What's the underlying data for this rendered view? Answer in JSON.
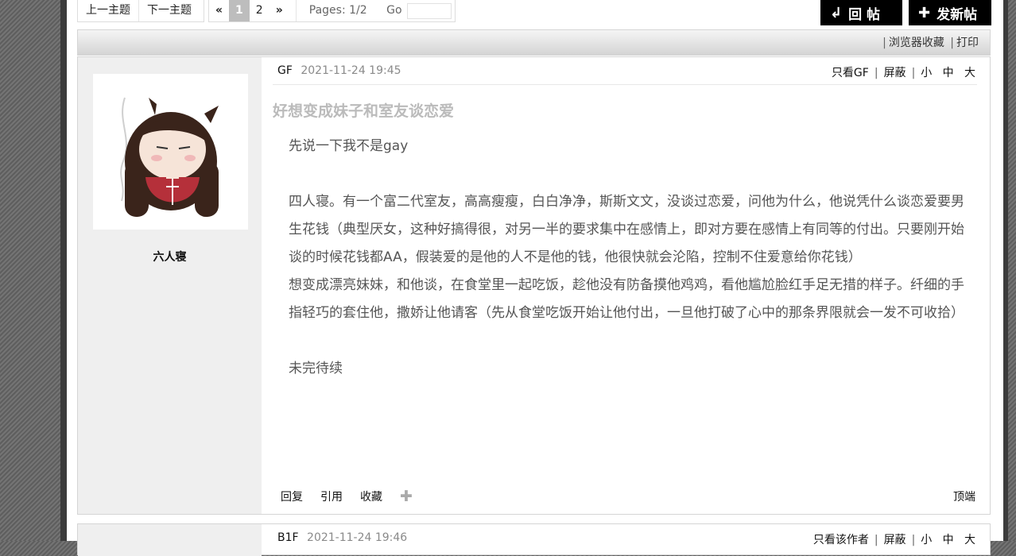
{
  "nav": {
    "prev_topic": "上一主题",
    "next_topic": "下一主题"
  },
  "pagination": {
    "prev": "«",
    "pages": [
      "1",
      "2"
    ],
    "current": "1",
    "next": "»",
    "info": "Pages: 1/2",
    "go": "Go"
  },
  "buttons": {
    "reply_icon": "↲",
    "reply": "回 帖",
    "new_icon": "✚",
    "new_post": "发新帖"
  },
  "toolbar": {
    "bookmark": "浏览器收藏",
    "print": "打印"
  },
  "post1": {
    "author": "GF",
    "date": "2021-11-24 19:45",
    "only_author": "只看GF",
    "block": "屏蔽",
    "size_small": "小",
    "size_medium": "中",
    "size_large": "大",
    "username": "六人寝",
    "title": "好想变成妹子和室友谈恋爱",
    "p1": "先说一下我不是gay",
    "p2": "四人寝。有一个富二代室友，高高瘦瘦，白白净净，斯斯文文，没谈过恋爱，问他为什么，他说凭什么谈恋爱要男生花钱（典型厌女，这种好搞得很，对另一半的要求集中在感情上，即对方要在感情上有同等的付出。只要刚开始谈的时候花钱都AA，假装爱的是他的人不是他的钱，他很快就会沦陷，控制不住爱意给你花钱）",
    "p3": "想变成漂亮妹妹，和他谈，在食堂里一起吃饭，趁他没有防备摸他鸡鸡，看他尴尬脸红手足无措的样子。纤细的手指轻巧的套住他，撒娇让他请客（先从食堂吃饭开始让他付出，一旦他打破了心中的那条界限就会一发不可收拾）",
    "p4": "未完待续",
    "actions": {
      "reply": "回复",
      "quote": "引用",
      "favorite": "收藏",
      "more_icon": "plus-icon"
    },
    "top": "顶端"
  },
  "post2": {
    "floor": "B1F",
    "date": "2021-11-24 19:46",
    "only_author": "只看该作者",
    "block": "屏蔽",
    "size_small": "小",
    "size_medium": "中",
    "size_large": "大"
  }
}
